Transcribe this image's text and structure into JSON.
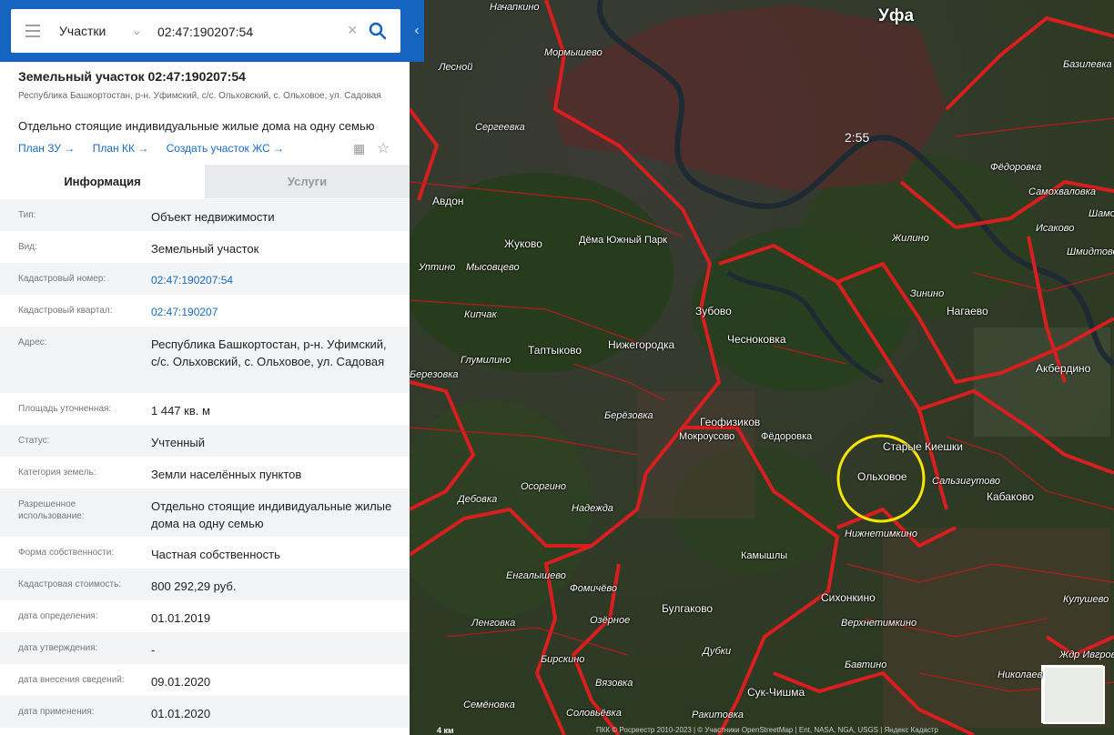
{
  "search": {
    "category": "Участки",
    "query": "02:47:190207:54"
  },
  "parcel": {
    "title": "Земельный участок 02:47:190207:54",
    "address_short": "Республика Башкортостан, р-н. Уфимский, с/с. Ольховский, с. Ольховое, ул. Садовая",
    "use": "Отдельно стоящие индивидуальные жилые дома на одну семью",
    "links": [
      "План ЗУ →",
      "План КК →",
      "Создать участок ЖС →"
    ]
  },
  "tabs": [
    "Информация",
    "Услуги"
  ],
  "info_rows": [
    {
      "key": "Тип:",
      "value": "Объект недвижимости"
    },
    {
      "key": "Вид:",
      "value": "Земельный участок"
    },
    {
      "key": "Кадастровый номер:",
      "value": "02:47:190207:54"
    },
    {
      "key": "Кадастровый квартал:",
      "value": "02:47:190207"
    },
    {
      "key": "Адрес:",
      "value": "Республика Башкортостан, р-н. Уфимский, с/с. Ольховский, с. Ольховое, ул. Садовая"
    },
    {
      "key": "Площадь уточненная:",
      "value": "1 447 кв. м"
    },
    {
      "key": "Статус:",
      "value": "Учтенный"
    },
    {
      "key": "Категория земель:",
      "value": "Земли населённых пунктов"
    },
    {
      "key": "Разрешенное использование:",
      "value": "Отдельно стоящие индивидуальные жилые дома на одну семью"
    },
    {
      "key": "Форма собственности:",
      "value": "Частная собственность"
    },
    {
      "key": "Кадастровая стоимость:",
      "value": "800 292,29 руб."
    },
    {
      "key": "дата определения:",
      "value": "01.01.2019"
    },
    {
      "key": "дата утверждения:",
      "value": "-"
    },
    {
      "key": "дата внесения сведений:",
      "value": "09.01.2020"
    },
    {
      "key": "дата применения:",
      "value": "01.01.2020"
    }
  ],
  "map": {
    "city": "Уфа",
    "road_label": "2:55",
    "places": [
      "Начапкино",
      "Мормышево",
      "Лесной",
      "Сергеевка",
      "Авдон",
      "Жуково",
      "Дёма Южный Парк",
      "Уптино",
      "Мысовцево",
      "Кипчак",
      "Таптыково",
      "Глумилино",
      "Нижегородка",
      "Зубово",
      "Чесноковка",
      "Геофизиков",
      "Мокроусово",
      "Фёдоровка",
      "Берёзовка",
      "Осоргино",
      "Дебовка",
      "Надежда",
      "Камышлы",
      "Енгалышево",
      "Фомичёво",
      "Озёрное",
      "Булгаково",
      "Дубки",
      "Вязовка",
      "Ленговка",
      "Семёновка",
      "Соловьёвка",
      "Ракитовка",
      "Сук-Чишма",
      "Бавтино",
      "Верхнетимкино",
      "Сихонкино",
      "Нижнетимкино",
      "Ольховое",
      "Старые Киешки",
      "Сальзигутово",
      "Кабаково",
      "Жилино",
      "Зинино",
      "Нагаево",
      "Акбердино",
      "Исаково",
      "Самохваловка",
      "Базилевка",
      "Фёдоровка",
      "Шамо",
      "Шмидтово",
      "Кулушево",
      "Ждр Ивгрово",
      "Николаевка",
      "Березовка",
      "Бирскино"
    ],
    "attribution": "ПКК © Росреестр 2010-2023 | © Участники OpenStreetMap | Ent, NASA, NGA, USGS | Яндекс Кадастр",
    "scale": "4 км"
  }
}
